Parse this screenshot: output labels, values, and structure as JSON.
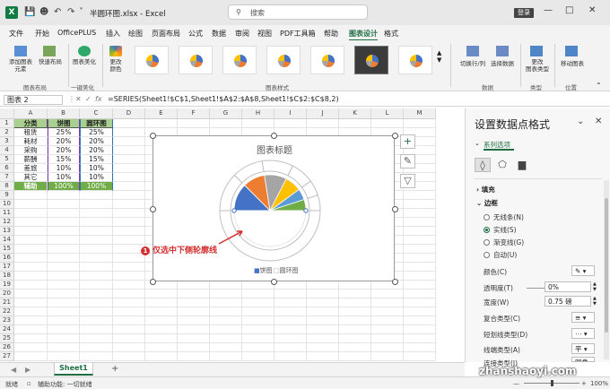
{
  "titlebar": {
    "filename": "半圆环图.xlsx",
    "separator": "-",
    "app": "Excel",
    "search_placeholder": "搜索",
    "login": "登录",
    "icons": [
      "excel-logo",
      "save-icon",
      "user-icon",
      "undo-icon",
      "redo-icon",
      "customize-icon"
    ]
  },
  "menu": {
    "items": [
      "文件",
      "开始",
      "OfficePLUS",
      "插入",
      "绘图",
      "页面布局",
      "公式",
      "数据",
      "审阅",
      "视图",
      "PDF工具箱",
      "帮助",
      "图表设计",
      "格式"
    ],
    "active": "图表设计",
    "share": "共享"
  },
  "ribbon": {
    "add_element": "添加图表\n元素",
    "quick_layout": "快速布局",
    "group_layout": "图表布局",
    "beautify": "图表美化",
    "group_onekey": "一键美化",
    "change_colors": "更改\n颜色",
    "group_styles": "图表样式",
    "switch_rowcol": "切换行/列",
    "select_data": "选择数据",
    "group_data": "数据",
    "change_type": "更改\n图表类型",
    "group_type": "类型",
    "move_chart": "移动图表",
    "group_location": "位置"
  },
  "formula_bar": {
    "namebox": "图表 2",
    "fx": "fx",
    "formula": "=SERIES(Sheet1!$C$1,Sheet1!$A$2:$A$8,Sheet1!$C$2:$C$8,2)"
  },
  "grid": {
    "columns": [
      "A",
      "B",
      "C",
      "D",
      "E",
      "F",
      "G",
      "H",
      "I",
      "J",
      "K",
      "L",
      "M"
    ],
    "rows": [
      "1",
      "2",
      "3",
      "4",
      "5",
      "6",
      "7",
      "8",
      "9",
      "10",
      "11",
      "12",
      "13",
      "14",
      "15",
      "16",
      "17",
      "18",
      "19",
      "20",
      "21",
      "22",
      "23",
      "24",
      "25",
      "26",
      "27"
    ],
    "table": [
      [
        "分类",
        "饼图",
        "圆环图"
      ],
      [
        "租赁",
        "25%",
        "25%"
      ],
      [
        "耗材",
        "20%",
        "20%"
      ],
      [
        "采购",
        "20%",
        "20%"
      ],
      [
        "薪酬",
        "15%",
        "15%"
      ],
      [
        "差旅",
        "10%",
        "10%"
      ],
      [
        "其它",
        "10%",
        "10%"
      ],
      [
        "辅助",
        "100%",
        "100%"
      ]
    ]
  },
  "chart": {
    "title": "图表标题",
    "legend": [
      "饼图",
      "圆环图"
    ],
    "side_buttons": [
      "+",
      "brush",
      "filter"
    ]
  },
  "chart_data": {
    "type": "pie",
    "title": "图表标题",
    "categories": [
      "租赁",
      "耗材",
      "采购",
      "薪酬",
      "差旅",
      "其它",
      "辅助"
    ],
    "series": [
      {
        "name": "饼图",
        "values": [
          25,
          20,
          20,
          15,
          10,
          10,
          100
        ]
      },
      {
        "name": "圆环图",
        "values": [
          25,
          20,
          20,
          15,
          10,
          10,
          100
        ]
      }
    ],
    "colors": [
      "#4472c4",
      "#ed7d31",
      "#a5a5a5",
      "#ffc000",
      "#5b9bd5",
      "#70ad47"
    ]
  },
  "annotation": {
    "number": "1",
    "text": "仅选中下侧轮廓线"
  },
  "panel": {
    "title": "设置数据点格式",
    "tab": "系列选项",
    "sections": {
      "fill": "填充",
      "border": "边框"
    },
    "radios": [
      "无线条(N)",
      "实线(S)",
      "渐变线(G)",
      "自动(U)"
    ],
    "radio_selected": 1,
    "props": [
      {
        "label": "颜色(C)",
        "value": ""
      },
      {
        "label": "透明度(T)",
        "value": "0%"
      },
      {
        "label": "宽度(W)",
        "value": "0.75 磅"
      },
      {
        "label": "复合类型(C)",
        "value": ""
      },
      {
        "label": "短划线类型(D)",
        "value": ""
      },
      {
        "label": "线端类型(A)",
        "value": "平"
      },
      {
        "label": "连接类型(J)",
        "value": "圆角"
      }
    ]
  },
  "sheets": {
    "tab": "Sheet1",
    "add": "+"
  },
  "status": {
    "ready": "就绪",
    "accessibility": "辅助功能: 一切就绪",
    "zoom": "100%",
    "watermark": "zhanshaoyi.com"
  }
}
